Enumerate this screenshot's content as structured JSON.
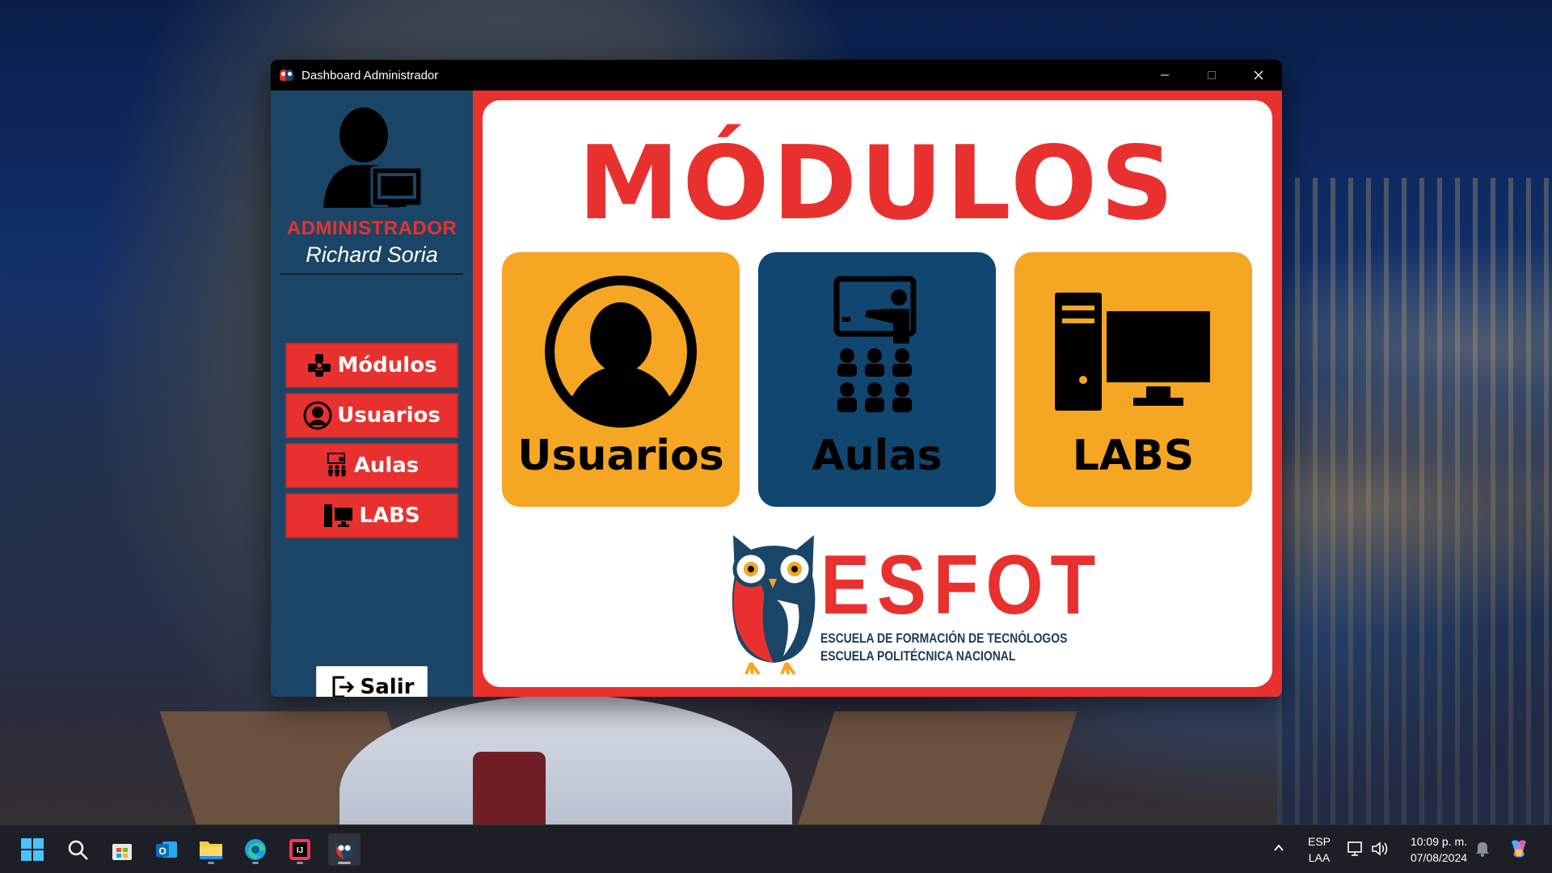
{
  "window": {
    "title": "Dashboard Administrador"
  },
  "sidebar": {
    "role": "ADMINISTRADOR",
    "user_name": "Richard Soria",
    "nav": [
      {
        "label": "Módulos",
        "icon": "modules-icon"
      },
      {
        "label": "Usuarios",
        "icon": "user-circle-icon"
      },
      {
        "label": "Aulas",
        "icon": "classroom-icon"
      },
      {
        "label": "LABS",
        "icon": "computer-lab-icon"
      }
    ],
    "exit_label": "Salir"
  },
  "main": {
    "title": "MÓDULOS",
    "tiles": [
      {
        "label": "Usuarios",
        "icon": "user-circle-icon",
        "color": "#f5a623"
      },
      {
        "label": "Aulas",
        "icon": "classroom-icon",
        "color": "#114670"
      },
      {
        "label": "LABS",
        "icon": "computer-lab-icon",
        "color": "#f5a623"
      }
    ],
    "logo": {
      "name": "ESFOT",
      "line1": "ESCUELA DE FORMACIÓN DE TECNÓLOGOS",
      "line2": "ESCUELA POLITÉCNICA NACIONAL"
    }
  },
  "taskbar": {
    "language": "ESP",
    "layout": "LAA",
    "time": "10:09 p. m.",
    "date": "07/08/2024"
  },
  "colors": {
    "accent_red": "#e8312f",
    "sidebar_blue": "#1b4566",
    "tile_orange": "#f5a623",
    "tile_blue": "#114670"
  }
}
